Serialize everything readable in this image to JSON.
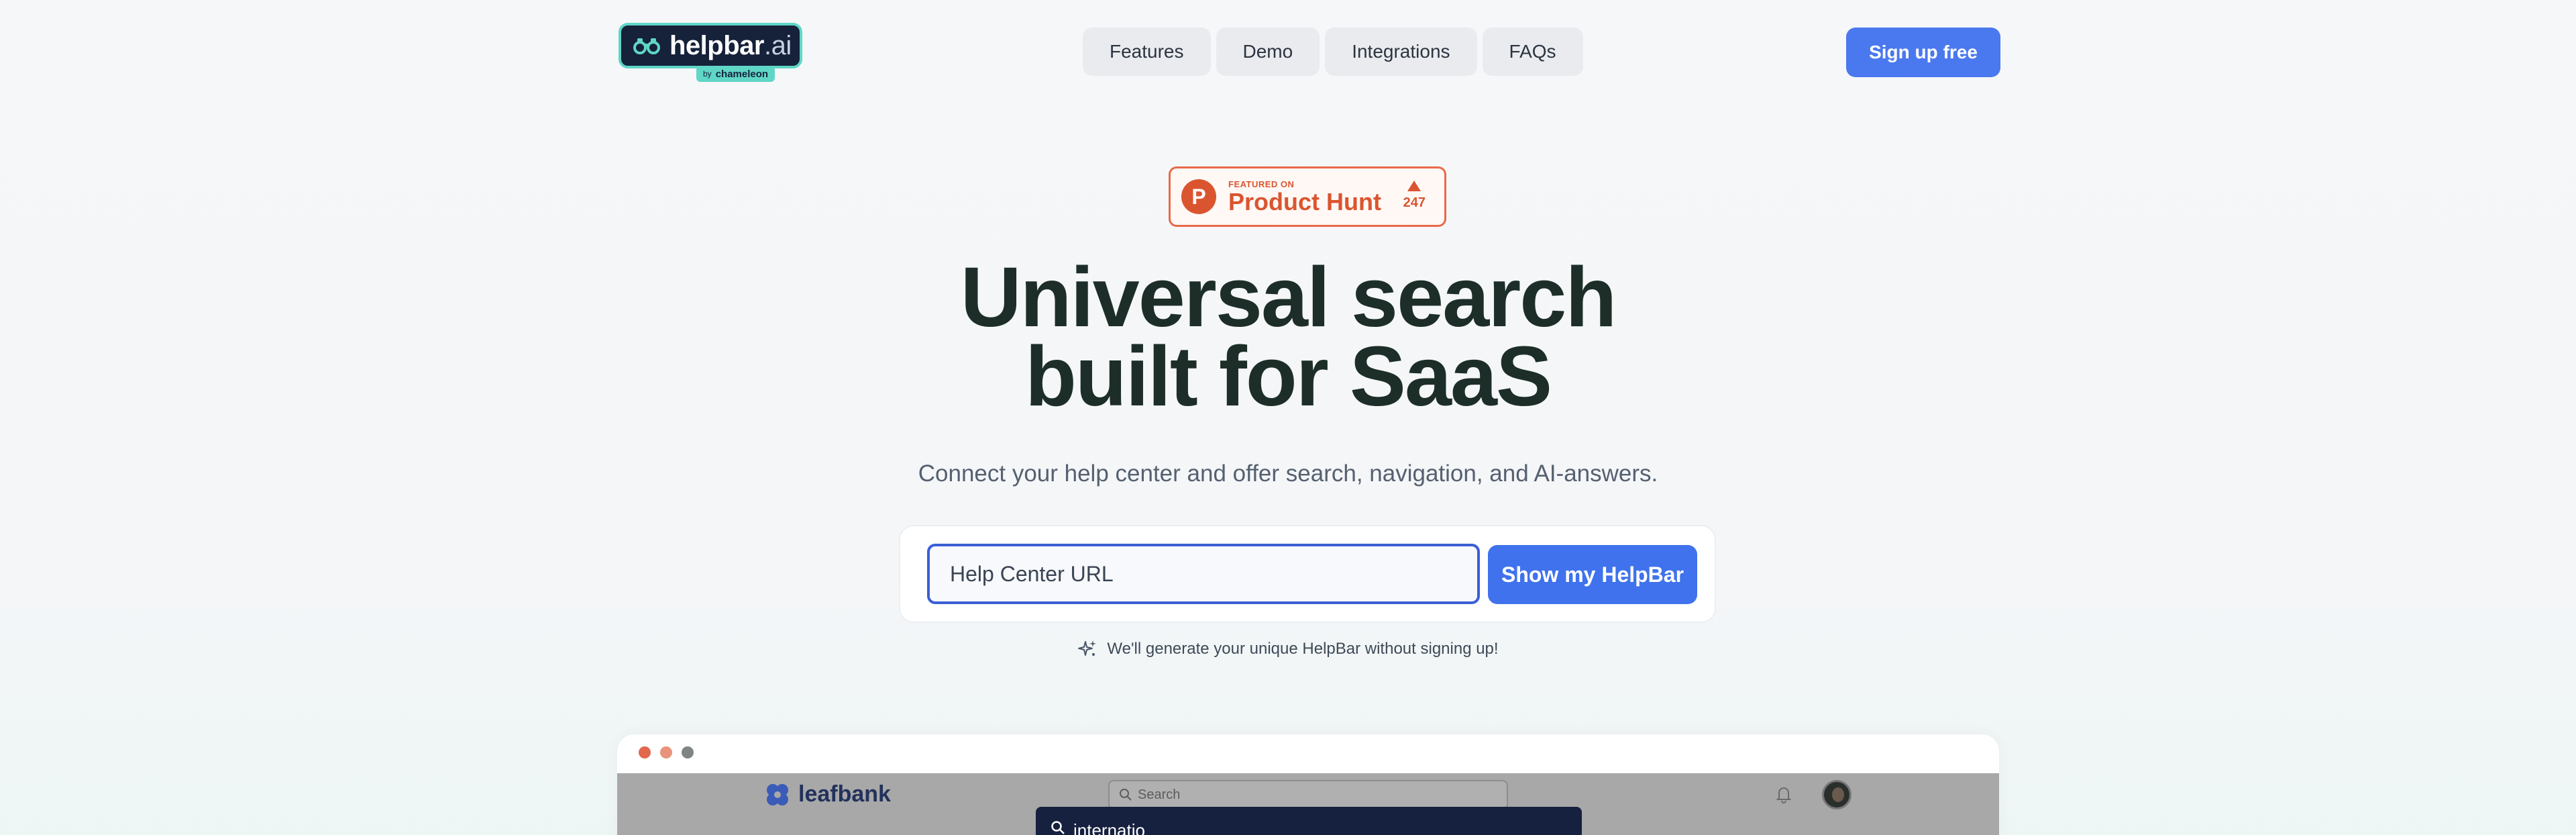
{
  "header": {
    "logo_text": "helpbar",
    "logo_suffix": ".ai",
    "logo_badge_prefix": "by",
    "logo_badge_name": "chameleon",
    "nav": [
      {
        "label": "Features"
      },
      {
        "label": "Demo"
      },
      {
        "label": "Integrations"
      },
      {
        "label": "FAQs"
      }
    ],
    "signup_label": "Sign up free"
  },
  "product_hunt": {
    "logo_letter": "P",
    "small_text": "FEATURED ON",
    "name": "Product Hunt",
    "votes": "247"
  },
  "hero": {
    "title_line1": "Universal search",
    "title_line2": "built for SaaS",
    "subtitle": "Connect your help center and offer search, navigation, and AI-answers."
  },
  "form": {
    "input_placeholder": "Help Center URL",
    "button_label": "Show my HelpBar",
    "note": "We'll generate your unique HelpBar without signing up!"
  },
  "demo": {
    "window_dots": [
      "#e2674d",
      "#e8937c",
      "#7f8583"
    ],
    "app_name": "leafbank",
    "search_placeholder": "Search",
    "query": "internatio"
  },
  "colors": {
    "accent": "#4a78ee",
    "logo_border": "#5fd6c6",
    "product_hunt": "#da552f",
    "heading": "#1d2e29"
  }
}
